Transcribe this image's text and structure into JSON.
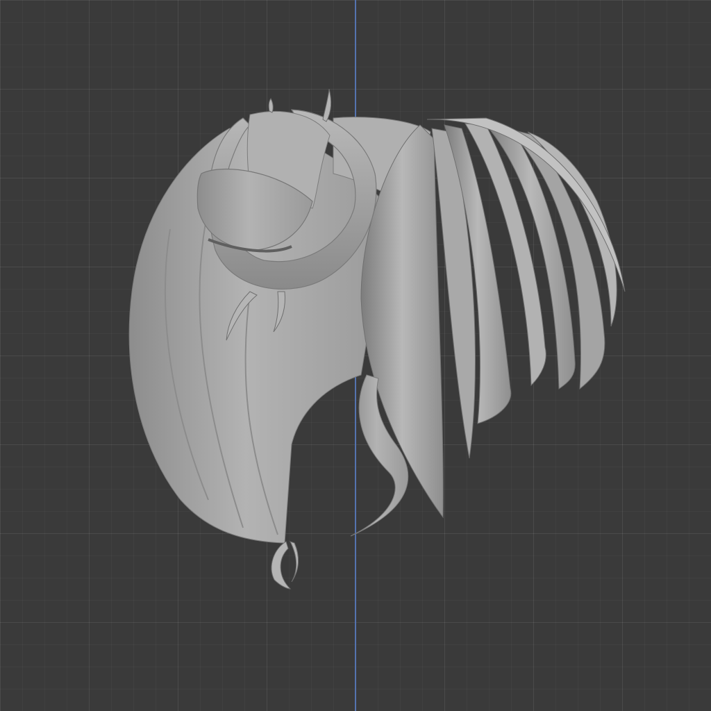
{
  "viewport": {
    "background": "#3a3a3a",
    "grid_color": "#484848",
    "axis_z_color": "#5473b0",
    "model_color": "#a6a6a6",
    "object_type": "hair-mesh"
  }
}
